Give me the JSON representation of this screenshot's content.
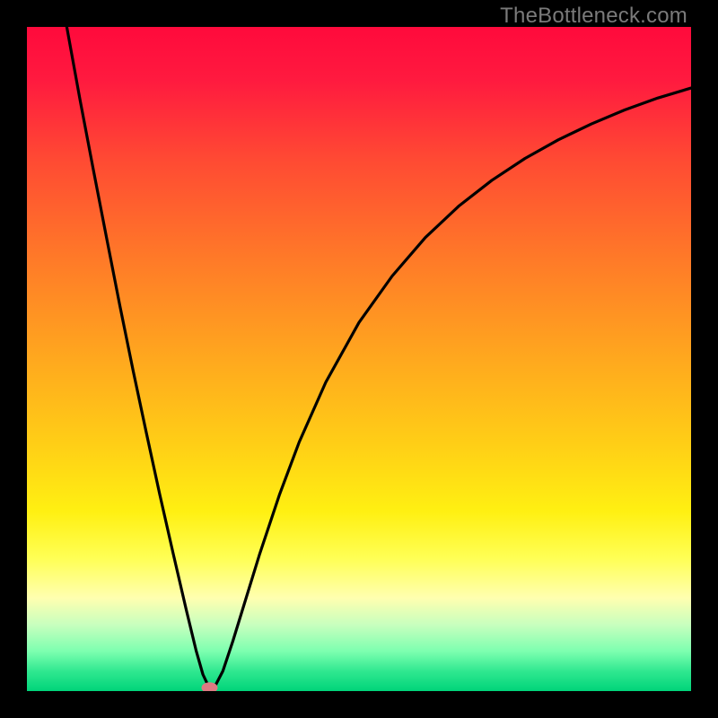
{
  "watermark": "TheBottleneck.com",
  "chart_data": {
    "type": "line",
    "title": "",
    "xlabel": "",
    "ylabel": "",
    "xlim": [
      0,
      100
    ],
    "ylim": [
      0,
      100
    ],
    "background_gradient": {
      "stops": [
        {
          "offset": 0.0,
          "color": "#ff0a3c"
        },
        {
          "offset": 0.08,
          "color": "#ff1a3f"
        },
        {
          "offset": 0.2,
          "color": "#ff4a33"
        },
        {
          "offset": 0.35,
          "color": "#ff7a28"
        },
        {
          "offset": 0.5,
          "color": "#ffa81e"
        },
        {
          "offset": 0.63,
          "color": "#ffcf16"
        },
        {
          "offset": 0.73,
          "color": "#fff012"
        },
        {
          "offset": 0.8,
          "color": "#ffff55"
        },
        {
          "offset": 0.86,
          "color": "#ffffb0"
        },
        {
          "offset": 0.9,
          "color": "#c8ffbe"
        },
        {
          "offset": 0.94,
          "color": "#7dffb0"
        },
        {
          "offset": 0.97,
          "color": "#30e890"
        },
        {
          "offset": 1.0,
          "color": "#00d47a"
        }
      ]
    },
    "series": [
      {
        "name": "bottleneck-curve",
        "color": "#000000",
        "points": [
          {
            "x": 6.0,
            "y": 100.0
          },
          {
            "x": 8.0,
            "y": 89.0
          },
          {
            "x": 10.0,
            "y": 78.5
          },
          {
            "x": 12.0,
            "y": 68.2
          },
          {
            "x": 14.0,
            "y": 58.0
          },
          {
            "x": 16.0,
            "y": 48.2
          },
          {
            "x": 18.0,
            "y": 38.8
          },
          {
            "x": 20.0,
            "y": 29.6
          },
          {
            "x": 22.0,
            "y": 20.8
          },
          {
            "x": 24.0,
            "y": 12.2
          },
          {
            "x": 25.5,
            "y": 6.0
          },
          {
            "x": 26.5,
            "y": 2.5
          },
          {
            "x": 27.4,
            "y": 0.6
          },
          {
            "x": 28.3,
            "y": 0.7
          },
          {
            "x": 29.5,
            "y": 3.0
          },
          {
            "x": 31.0,
            "y": 7.5
          },
          {
            "x": 33.0,
            "y": 14.0
          },
          {
            "x": 35.0,
            "y": 20.5
          },
          {
            "x": 38.0,
            "y": 29.5
          },
          {
            "x": 41.0,
            "y": 37.5
          },
          {
            "x": 45.0,
            "y": 46.5
          },
          {
            "x": 50.0,
            "y": 55.5
          },
          {
            "x": 55.0,
            "y": 62.5
          },
          {
            "x": 60.0,
            "y": 68.3
          },
          {
            "x": 65.0,
            "y": 73.0
          },
          {
            "x": 70.0,
            "y": 76.9
          },
          {
            "x": 75.0,
            "y": 80.2
          },
          {
            "x": 80.0,
            "y": 83.0
          },
          {
            "x": 85.0,
            "y": 85.4
          },
          {
            "x": 90.0,
            "y": 87.5
          },
          {
            "x": 95.0,
            "y": 89.3
          },
          {
            "x": 100.0,
            "y": 90.8
          }
        ]
      }
    ],
    "marker": {
      "x": 27.5,
      "y": 0.5,
      "color": "#de7a82",
      "rx": 9,
      "ry": 6
    }
  }
}
